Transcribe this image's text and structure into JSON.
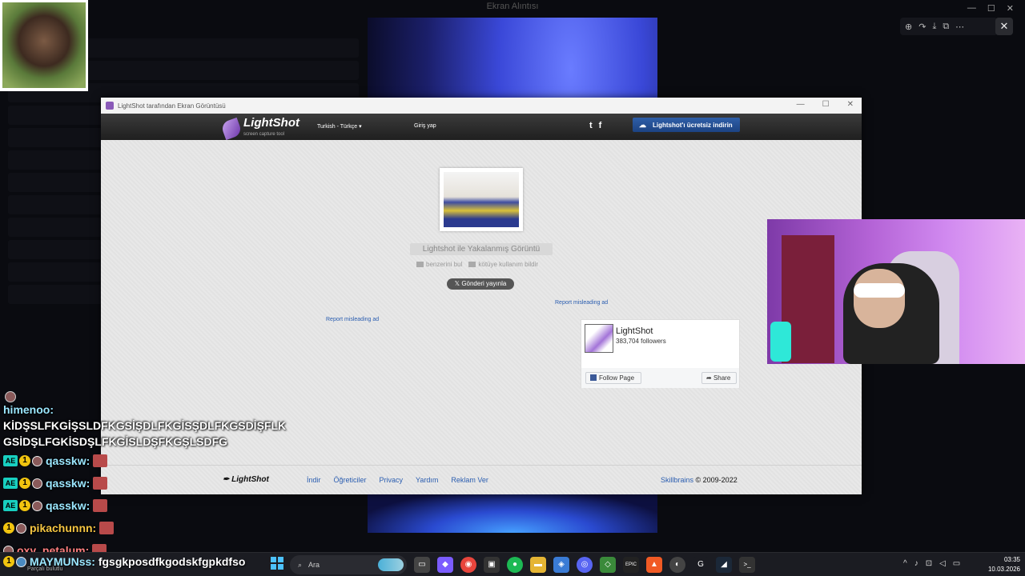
{
  "viewer": {
    "title": "Ekran Alıntısı",
    "controls": [
      "—",
      "☐",
      "✕"
    ],
    "tools": [
      "⊕",
      "↷",
      "⤓",
      "⧉",
      "⋯"
    ],
    "close": "✕"
  },
  "lightshot_window": {
    "title": "LightShot tarafından Ekran Görüntüsü",
    "controls": [
      "—",
      "☐",
      "✕"
    ],
    "header": {
      "logo": "LightShot",
      "logo_sub": "screen capture tool",
      "language": "Turkish - Türkçe",
      "login": "Giriş yap",
      "social": [
        "t",
        "f"
      ],
      "download_button": "Lightshot'ı ücretsiz indirin"
    },
    "content": {
      "caption": "Lightshot ile Yakalanmış Görüntü",
      "similar_link": "benzerini bul",
      "report_link": "kötüye kullanım bildir",
      "tweet_button": "Gönderi yayınla",
      "report_ad_right": "Report misleading ad",
      "report_ad_left": "Report misleading ad",
      "facebook": {
        "name": "LightShot",
        "followers": "383,704 followers",
        "follow_button": "Follow Page",
        "share_button": "Share"
      }
    },
    "footer": {
      "logo": "LightShot",
      "links": [
        "İndir",
        "Öğreticiler",
        "Privacy",
        "Yardım",
        "Reklam Ver"
      ],
      "company": "Skillbrains",
      "copyright": "© 2009-2022"
    }
  },
  "chat": {
    "messages": [
      {
        "user": "himenoo:",
        "text": "KİDŞSLFKGİŞSLDFKGSİŞDLFKGİSŞDLFKGSDİŞFLK GSİDŞLFGKİSDŞLFKGİSLDŞFKGŞLSDFG"
      },
      {
        "user": "qasskw:",
        "badge": "AE"
      },
      {
        "user": "qasskw:",
        "badge": "AE"
      },
      {
        "user": "qasskw:",
        "badge": "AE"
      },
      {
        "user": "pikachunnn:"
      },
      {
        "user": "oxy_petalum:"
      }
    ],
    "bottom": {
      "user": "MAYMUNss:",
      "text": "fgsgkposdfkgodskfgpkdfso",
      "sub": "Parçalı bulutlu"
    }
  },
  "taskbar": {
    "search_placeholder": "Ara",
    "icons": [
      "▭",
      "◆",
      "◉",
      "▣",
      "●",
      "▬",
      "◈",
      "◎",
      "◇",
      "EPIC",
      "▲",
      "◐",
      "G",
      "◢",
      ">_"
    ],
    "tray": [
      "^",
      "♪",
      "⊡",
      "◁",
      "▭"
    ],
    "time": "03:35",
    "date": "10.03.2026"
  }
}
